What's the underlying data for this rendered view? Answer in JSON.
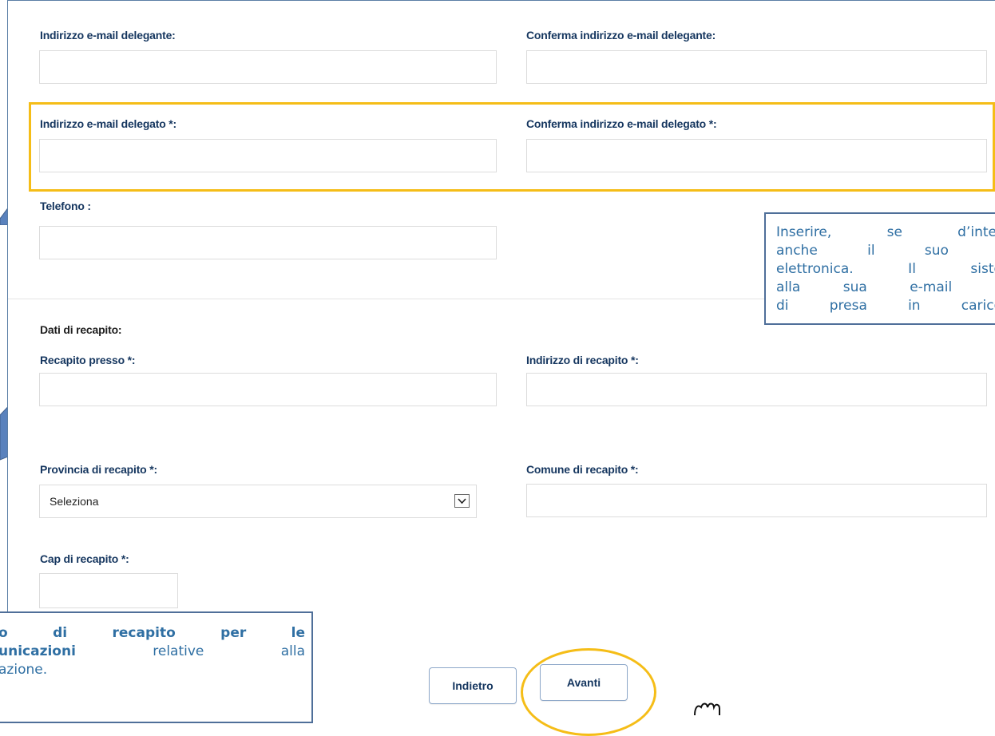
{
  "form": {
    "email_delegante_label": "Indirizzo e-mail delegante:",
    "conferma_email_delegante_label": "Conferma indirizzo e-mail delegante:",
    "email_delegato_label": "Indirizzo e-mail delegato *:",
    "conferma_email_delegato_label": "Conferma indirizzo e-mail delegato *:",
    "telefono_label": "Telefono :",
    "dati_recapito_heading": "Dati di recapito:",
    "recapito_presso_label": "Recapito presso *:",
    "indirizzo_recapito_label": "Indirizzo di recapito *:",
    "provincia_label": "Provincia di recapito *:",
    "provincia_value": "Seleziona",
    "comune_label": "Comune di recapito *:",
    "cap_label": "Cap di recapito *:"
  },
  "buttons": {
    "indietro": "Indietro",
    "avanti": "Avanti"
  },
  "callout_right": {
    "lines": [
      "Inserire, se d’inter",
      "anche il suo i",
      "elettronica. Il siste",
      "alla sua e-mail c",
      "di presa in carico"
    ]
  },
  "callout_left": {
    "line1_bold": "o di recapito per le",
    "line2_bold": "unicazioni",
    "line2_rest": " relative alla",
    "line3": "azione."
  },
  "colors": {
    "highlight": "#f5bd17",
    "label_blue": "#15365f",
    "callout_text": "#2f6fa3",
    "callout_border": "#4f6f99",
    "pointer_fill": "#5a82bd"
  }
}
